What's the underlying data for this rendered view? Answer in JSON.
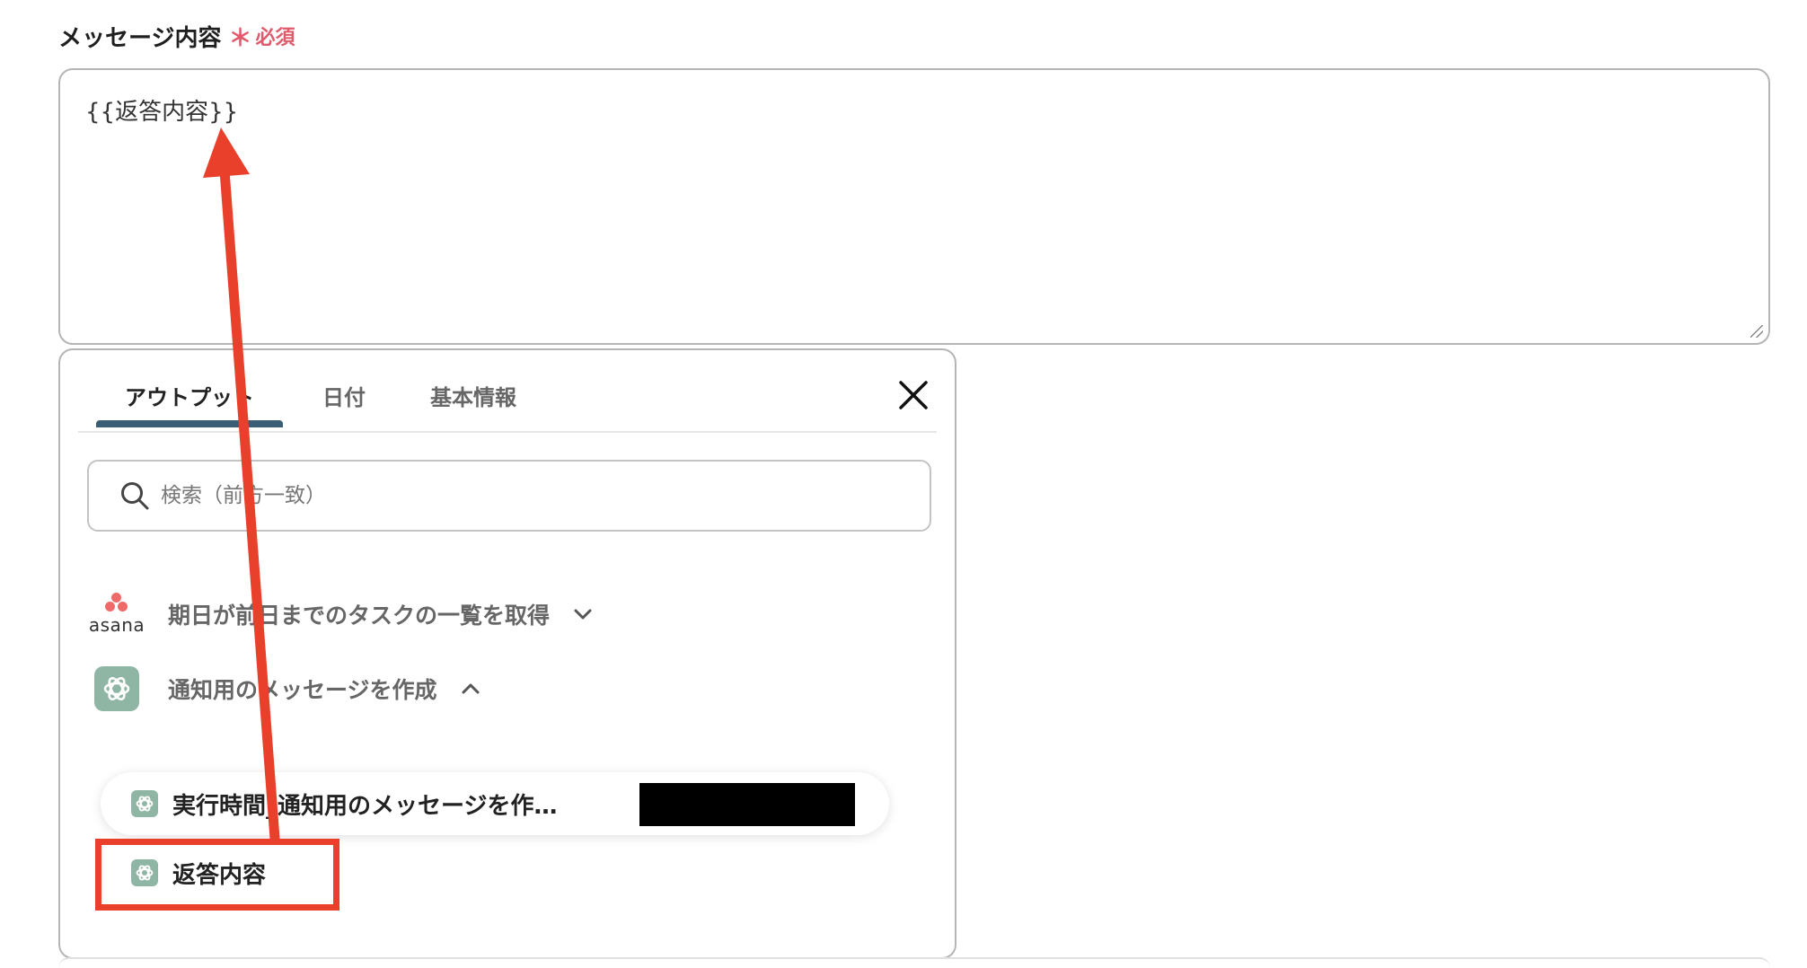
{
  "field": {
    "label": "メッセージ内容",
    "required_star": "＊",
    "required_text": "必須",
    "value": "{{返答内容}}"
  },
  "panel": {
    "tabs": [
      {
        "label": "アウトプット",
        "active": true
      },
      {
        "label": "日付",
        "active": false
      },
      {
        "label": "基本情報",
        "active": false
      }
    ],
    "search": {
      "placeholder": "検索（前方一致）"
    },
    "groups": [
      {
        "app": "asana",
        "app_word": "asana",
        "title": "期日が前日までのタスクの一覧を取得",
        "expanded": false
      },
      {
        "app": "chatgpt",
        "title": "通知用のメッセージを作成",
        "expanded": true
      }
    ],
    "items": [
      {
        "label": "実行時間_通知用のメッセージを作…",
        "value_redacted": true
      },
      {
        "label": "返答内容"
      }
    ]
  },
  "colors": {
    "accent": "#3a5f75",
    "required": "#e05a6b",
    "annotation": "#e8402b",
    "asana": "#f06a6a",
    "chatgpt": "#8fb5a5"
  }
}
